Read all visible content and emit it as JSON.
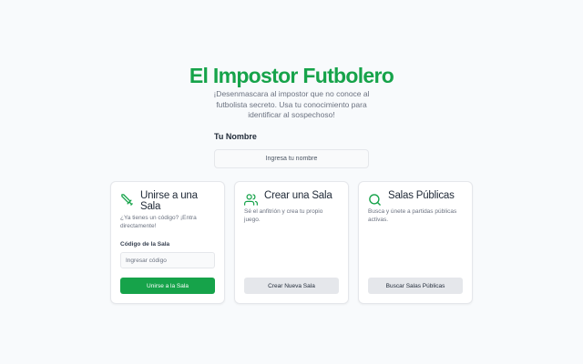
{
  "header": {
    "title": "El Impostor Futbolero",
    "subtitle": "¡Desenmascara al impostor que no conoce al futbolista secreto. Usa tu conocimiento para identificar al sospechoso!"
  },
  "name_field": {
    "label": "Tu Nombre",
    "placeholder": "Ingresa tu nombre"
  },
  "cards": {
    "join": {
      "icon": "sword-icon",
      "title": "Unirse a una Sala",
      "description": "¿Ya tienes un código? ¡Entra directamente!",
      "code_label": "Código de la Sala",
      "code_placeholder": "Ingresar código",
      "button_label": "Unirse a la Sala"
    },
    "create": {
      "icon": "users-icon",
      "title": "Crear una Sala",
      "description": "Sé el anfitrión y crea tu propio juego.",
      "button_label": "Crear Nueva Sala"
    },
    "public": {
      "icon": "search-icon",
      "title": "Salas Públicas",
      "description": "Busca y únete a partidas públicas activas.",
      "button_label": "Buscar Salas Públicas"
    }
  },
  "colors": {
    "accent": "#16a34a",
    "background": "#f8fafc",
    "secondary_button": "#e5e7eb"
  }
}
